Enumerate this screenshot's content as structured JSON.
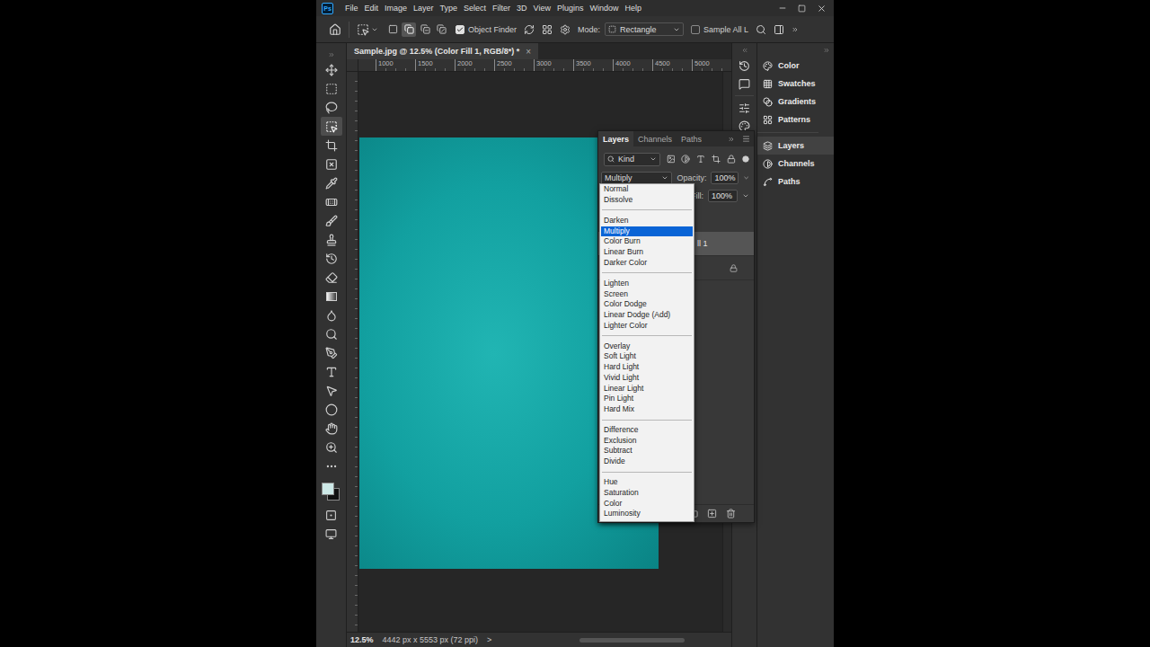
{
  "app": {
    "logo": "Ps"
  },
  "menu_bar": [
    "File",
    "Edit",
    "Image",
    "Layer",
    "Type",
    "Select",
    "Filter",
    "3D",
    "View",
    "Plugins",
    "Window",
    "Help"
  ],
  "options_bar": {
    "selection_modes": [
      {
        "selected": false
      },
      {
        "selected": true
      },
      {
        "selected": false
      },
      {
        "selected": false
      }
    ],
    "object_finder": {
      "label": "Object Finder",
      "checked": true
    },
    "mode_label": "Mode:",
    "mode_value": "Rectangle",
    "sample_all_layers": {
      "label": "Sample All L",
      "checked": false
    }
  },
  "toolbar": {
    "tools": [
      {
        "selected": false
      },
      {
        "selected": false
      },
      {
        "selected": false
      },
      {
        "selected": true
      },
      {
        "selected": false
      },
      {
        "selected": false
      },
      {
        "selected": false
      },
      {
        "selected": false
      },
      {
        "selected": false
      },
      {
        "selected": false
      },
      {
        "selected": false
      },
      {
        "selected": false
      },
      {
        "selected": false
      },
      {
        "selected": false
      },
      {
        "selected": false
      },
      {
        "selected": false
      },
      {
        "selected": false
      },
      {
        "selected": false
      },
      {
        "selected": false
      },
      {
        "selected": false
      },
      {
        "selected": false
      },
      {
        "selected": false
      }
    ],
    "foreground_color": "#cde9e7",
    "background_color": "#111111"
  },
  "document": {
    "tab_title": "Sample.jpg @ 12.5% (Color Fill 1, RGB/8*) *",
    "close": "×",
    "ruler_ticks": [
      "1000",
      "1500",
      "2000",
      "2500",
      "3000",
      "3500",
      "4000",
      "4500",
      "5000"
    ]
  },
  "status_bar": {
    "zoom": "12.5%",
    "info": "4442 px x 5553 px (72 ppi)",
    "arrow": ">"
  },
  "dock": {
    "groups": [
      [
        {
          "label": "Color",
          "selected": false
        },
        {
          "label": "Swatches",
          "selected": false
        },
        {
          "label": "Gradients",
          "selected": false
        },
        {
          "label": "Patterns",
          "selected": false
        }
      ],
      [
        {
          "label": "Layers",
          "selected": true
        },
        {
          "label": "Channels",
          "selected": false
        },
        {
          "label": "Paths",
          "selected": false
        }
      ]
    ]
  },
  "layers_panel": {
    "tabs": [
      {
        "label": "Layers",
        "selected": true
      },
      {
        "label": "Channels",
        "selected": false
      },
      {
        "label": "Paths",
        "selected": false
      }
    ],
    "filter": "Kind",
    "blend_mode": "Multiply",
    "opacity_label": "Opacity:",
    "opacity": "100%",
    "fill_label": "Fill:",
    "fill": "100%",
    "layers": [
      {
        "name": "ll 1",
        "selected": true,
        "locked": false
      },
      {
        "name": "",
        "selected": false,
        "locked": true
      }
    ]
  },
  "blend_menu": {
    "groups": [
      [
        {
          "label": "Normal",
          "selected": false
        },
        {
          "label": "Dissolve",
          "selected": false
        }
      ],
      [
        {
          "label": "Darken",
          "selected": false
        },
        {
          "label": "Multiply",
          "selected": true
        },
        {
          "label": "Color Burn",
          "selected": false
        },
        {
          "label": "Linear Burn",
          "selected": false
        },
        {
          "label": "Darker Color",
          "selected": false
        }
      ],
      [
        {
          "label": "Lighten",
          "selected": false
        },
        {
          "label": "Screen",
          "selected": false
        },
        {
          "label": "Color Dodge",
          "selected": false
        },
        {
          "label": "Linear Dodge (Add)",
          "selected": false
        },
        {
          "label": "Lighter Color",
          "selected": false
        }
      ],
      [
        {
          "label": "Overlay",
          "selected": false
        },
        {
          "label": "Soft Light",
          "selected": false
        },
        {
          "label": "Hard Light",
          "selected": false
        },
        {
          "label": "Vivid Light",
          "selected": false
        },
        {
          "label": "Linear Light",
          "selected": false
        },
        {
          "label": "Pin Light",
          "selected": false
        },
        {
          "label": "Hard Mix",
          "selected": false
        }
      ],
      [
        {
          "label": "Difference",
          "selected": false
        },
        {
          "label": "Exclusion",
          "selected": false
        },
        {
          "label": "Subtract",
          "selected": false
        },
        {
          "label": "Divide",
          "selected": false
        }
      ],
      [
        {
          "label": "Hue",
          "selected": false
        },
        {
          "label": "Saturation",
          "selected": false
        },
        {
          "label": "Color",
          "selected": false
        },
        {
          "label": "Luminosity",
          "selected": false
        }
      ]
    ]
  }
}
